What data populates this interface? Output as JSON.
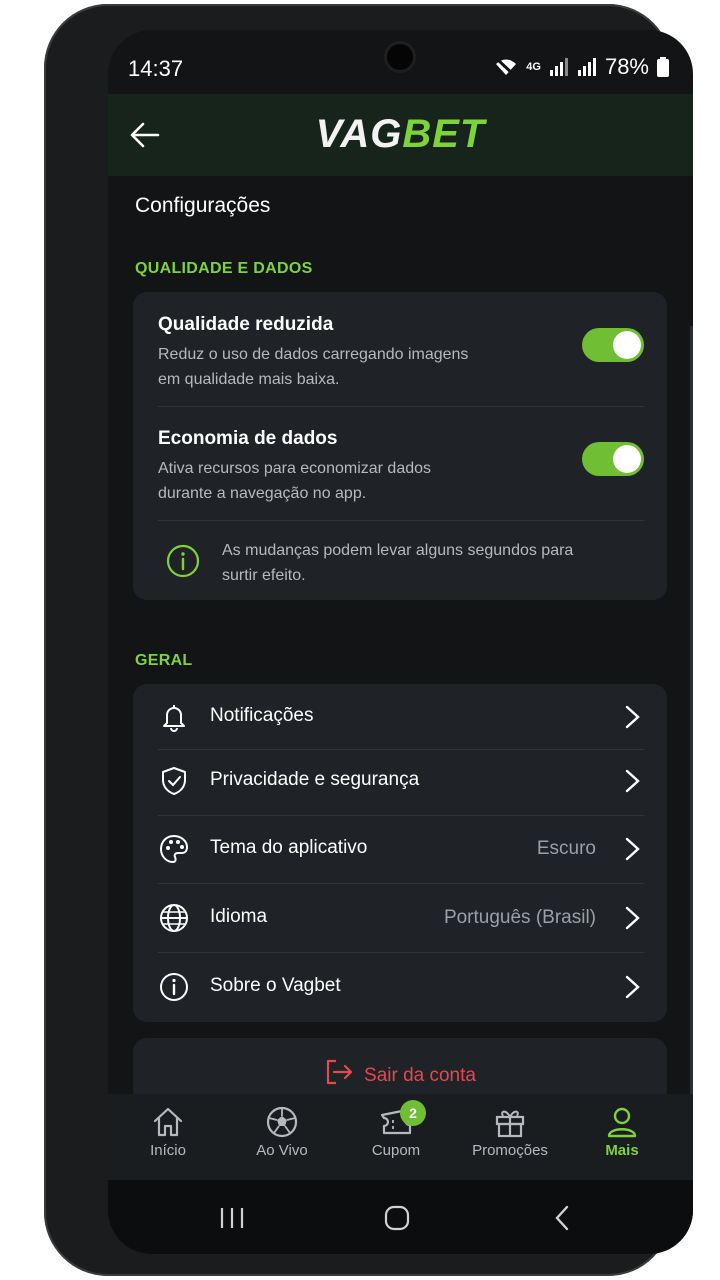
{
  "status_bar": {
    "time": "14:37",
    "network": "4G",
    "battery": "78%"
  },
  "header": {
    "logo_part1": "VAG",
    "logo_part2": "BET"
  },
  "page": {
    "title": "Configurações"
  },
  "sections": {
    "quality": {
      "label": "QUALIDADE E DADOS",
      "items": [
        {
          "title": "Qualidade reduzida",
          "description": "Reduz o uso de dados carregando imagens em qualidade mais baixa.",
          "enabled": true
        },
        {
          "title": "Economia de dados",
          "description": "Ativa recursos para economizar dados durante a navegação no app.",
          "enabled": true
        }
      ],
      "info": "As mudanças podem levar alguns segundos para surtir efeito."
    },
    "general": {
      "label": "GERAL",
      "items": [
        {
          "label": "Notificações",
          "icon": "bell-icon",
          "value": ""
        },
        {
          "label": "Privacidade e segurança",
          "icon": "shield-check-icon",
          "value": ""
        },
        {
          "label": "Tema do aplicativo",
          "icon": "palette-icon",
          "value": "Escuro"
        },
        {
          "label": "Idioma",
          "icon": "globe-icon",
          "value": "Português (Brasil)"
        },
        {
          "label": "Sobre o Vagbet",
          "icon": "info-icon",
          "value": ""
        }
      ]
    }
  },
  "logout": {
    "label": "Sair da conta"
  },
  "bottom_nav": {
    "items": [
      {
        "label": "Início",
        "icon": "home-icon"
      },
      {
        "label": "Ao Vivo",
        "icon": "soccer-ball-icon"
      },
      {
        "label": "Cupom",
        "icon": "ticket-icon",
        "badge": "2"
      },
      {
        "label": "Promoções",
        "icon": "gift-icon"
      },
      {
        "label": "Mais",
        "icon": "user-icon",
        "active": true
      }
    ]
  },
  "colors": {
    "accent": "#7ed33a",
    "danger": "#e5484d",
    "background": "#121416",
    "card": "#1f2327"
  }
}
